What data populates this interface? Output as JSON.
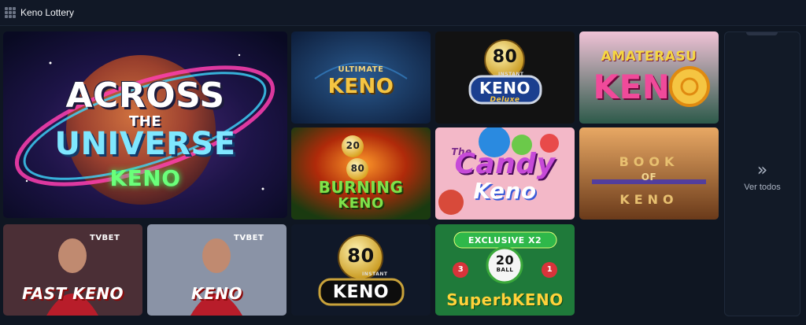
{
  "header": {
    "title": "Keno Lottery",
    "icon": "grid-icon"
  },
  "games": [
    {
      "id": "across-the-universe",
      "line1": "ACROSS",
      "line2": "THE",
      "line3": "UNIVERSE",
      "line4": "KENO"
    },
    {
      "id": "ultimate-keno",
      "line1": "ULTIMATE",
      "line2": "KENO"
    },
    {
      "id": "keno-80-instant-deluxe",
      "num": "80",
      "badge": "INSTANT",
      "line1": "KENO",
      "line2": "Deluxe"
    },
    {
      "id": "amaterasu-keno",
      "line1": "AMATERASU",
      "line2": "KEN"
    },
    {
      "id": "burning-keno",
      "ball1": "20",
      "ball2": "80",
      "line1": "BURNING",
      "line2": "KENO"
    },
    {
      "id": "candy-keno",
      "line0": "The",
      "line1": "Candy",
      "line2": "Keno"
    },
    {
      "id": "book-of-keno",
      "line1": "BOOK",
      "line2": "OF",
      "line3": "KENO"
    },
    {
      "id": "fast-keno",
      "brand": "TVBET",
      "title": "FAST KENO"
    },
    {
      "id": "tvbet-keno",
      "brand": "TVBET",
      "title": "KENO"
    },
    {
      "id": "keno-80-instant",
      "num": "80",
      "badge": "INSTANT",
      "title": "KENO"
    },
    {
      "id": "superb-keno",
      "ribbon": "EXCLUSIVE X2",
      "ball_num": "20",
      "ball_lbl": "BALL",
      "title": "SuperbKENO",
      "side1": "3",
      "side2": "1"
    }
  ],
  "see_all": {
    "label": "Ver todos",
    "icon": "double-chevron-right-icon",
    "glyph": "»"
  },
  "colors": {
    "background": "#0f1622",
    "header": "#111826",
    "card": "#121a27",
    "muted_text": "#aab3c2"
  }
}
